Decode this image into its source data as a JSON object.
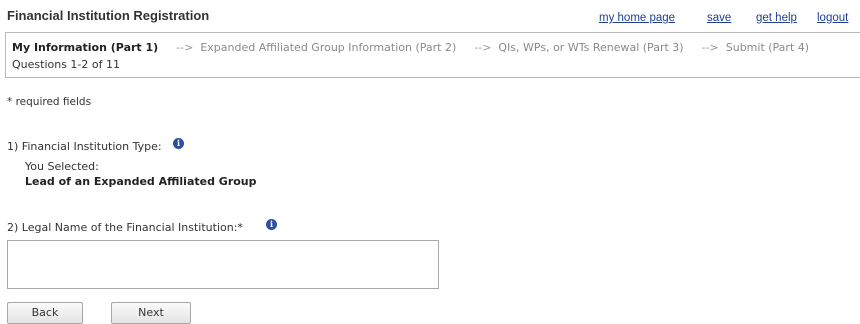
{
  "header": {
    "title": "Financial Institution Registration",
    "links": [
      "my home page",
      "save",
      "get help",
      "logout"
    ]
  },
  "steps": {
    "items": [
      "My Information (Part 1)",
      "Expanded Affiliated Group Information (Part 2)",
      "QIs, WPs, or WTs Renewal (Part 3)",
      "Submit (Part 4)"
    ],
    "arrow": "-->",
    "question_count": "Questions 1-2 of 11"
  },
  "form": {
    "required_note": "* required fields",
    "q1": {
      "label": "1) Financial Institution Type:",
      "selected_label": "You Selected:",
      "selected_value": "Lead of an Expanded Affiliated Group"
    },
    "q2": {
      "label": "2) Legal Name of the Financial Institution:*",
      "value": ""
    },
    "info_icon": "info-icon"
  },
  "buttons": {
    "back": "Back",
    "next": "Next"
  },
  "colors": {
    "link": "#1f3f93",
    "info_icon": "#2c4f9e",
    "border": "#b9b9b9"
  }
}
